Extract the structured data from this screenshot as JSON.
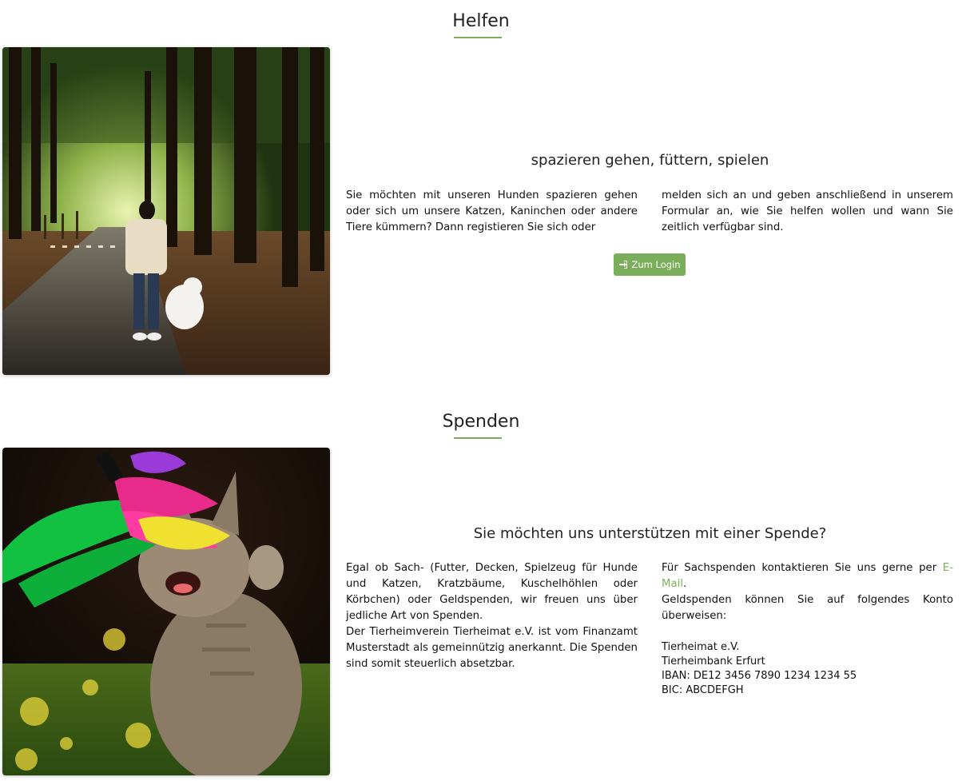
{
  "helfen": {
    "title": "Helfen",
    "image_alt": "Person walking a white dog on a forest path",
    "subtitle": "spazieren gehen, füttern, spielen",
    "text_left": "Sie möchten mit unseren Hunden spazieren gehen oder sich um unsere Katzen, Kaninchen oder andere Tiere kümmern? Dann registieren Sie sich oder",
    "text_right": "melden sich an und geben anschließend in unserem Formular an, wie Sie helfen wollen und wann Sie zeitlich verfügbar sind.",
    "login_button": "Zum Login",
    "login_icon": "sign-in-icon"
  },
  "spenden": {
    "title": "Spenden",
    "image_alt": "Kitten playing with colorful feathers",
    "subtitle": "Sie möchten uns unterstützen mit einer Spende?",
    "text_left_p1": "Egal ob Sach- (Futter, Decken, Spielzeug für Hunde und Katzen, Kratzbäume, Kuschelhöhlen oder Körbchen) oder Geldspenden, wir freuen uns über jedliche Art von Spenden.",
    "text_left_p2": "Der Tierheimverein Tierheimat e.V. ist vom Finanzamt Musterstadt als gemeinnützig anerkannt. Die Spenden sind somit steuerlich absetzbar.",
    "text_right_p1_before": "Für Sachspenden kontaktieren Sie uns gerne per ",
    "email_link": "E-Mail",
    "text_right_p1_after": ".",
    "text_right_p2": "Geldspenden können Sie auf folgendes Konto überweisen:",
    "bank": {
      "name": "Tierheimat e.V.",
      "bank_name": "Tierheimbank Erfurt",
      "iban": "IBAN: DE12 3456 7890 1234 1234 55",
      "bic": "BIC: ABCDEFGH"
    }
  },
  "colors": {
    "accent": "#7aae5a",
    "text": "#111111"
  }
}
